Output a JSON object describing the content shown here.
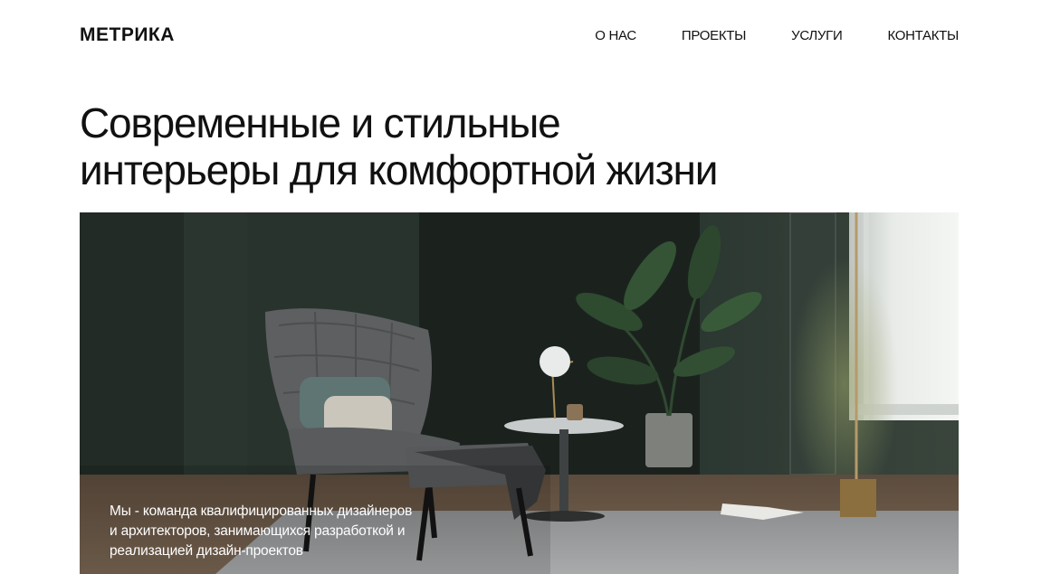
{
  "brand": {
    "logo_text": "МЕТРИКА"
  },
  "nav": {
    "items": [
      {
        "label": "О НАС"
      },
      {
        "label": "ПРОЕКТЫ"
      },
      {
        "label": "УСЛУГИ"
      },
      {
        "label": "КОНТАКТЫ"
      }
    ]
  },
  "hero": {
    "title_line_1": "Современные и стильные",
    "title_line_2": "интерьеры для комфортной жизни",
    "caption_line_1": "Мы - команда квалифицированных дизайнеров",
    "caption_line_2": "и архитекторов, занимающихся разработкой и",
    "caption_line_3": "реализацией дизайн-проектов"
  },
  "colors": {
    "text": "#111111",
    "background": "#ffffff",
    "wall_dark_green": "#26302b",
    "floor_wood": "#6b5a48"
  }
}
